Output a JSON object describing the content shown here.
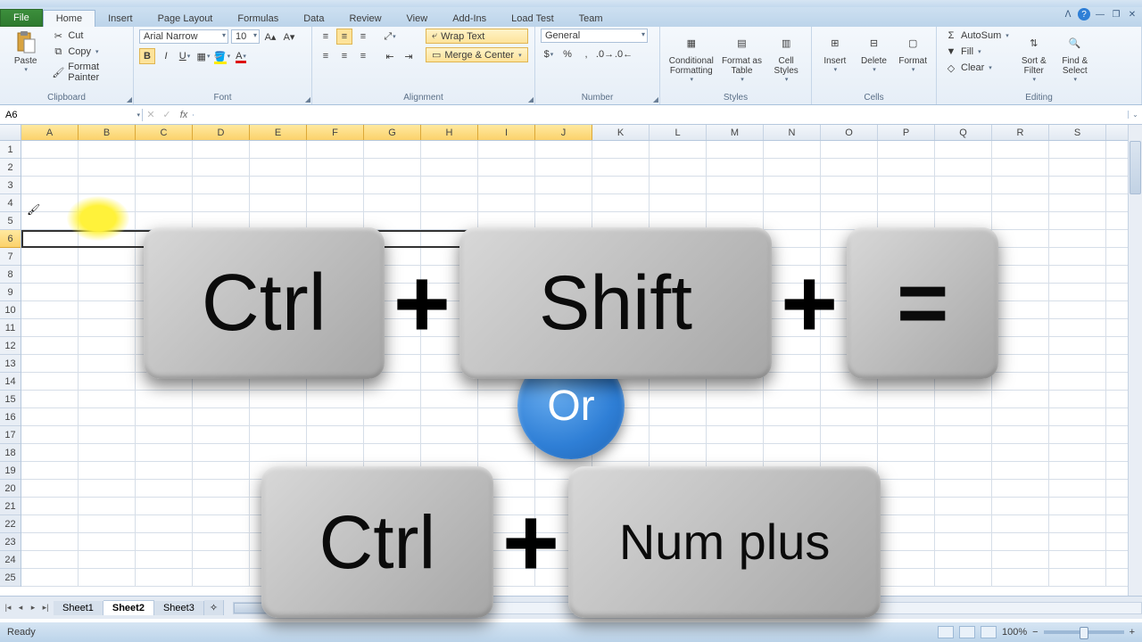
{
  "tabs": {
    "file": "File",
    "home": "Home",
    "insert": "Insert",
    "pageLayout": "Page Layout",
    "formulas": "Formulas",
    "data": "Data",
    "review": "Review",
    "view": "View",
    "addins": "Add-Ins",
    "loadtest": "Load Test",
    "team": "Team"
  },
  "clipboard": {
    "paste": "Paste",
    "cut": "Cut",
    "copy": "Copy",
    "formatPainter": "Format Painter",
    "title": "Clipboard"
  },
  "font": {
    "name": "Arial Narrow",
    "size": "10",
    "title": "Font"
  },
  "alignment": {
    "wrap": "Wrap Text",
    "merge": "Merge & Center",
    "title": "Alignment"
  },
  "number": {
    "format": "General",
    "title": "Number"
  },
  "styles": {
    "cond": "Conditional Formatting",
    "table": "Format as Table",
    "cell": "Cell Styles",
    "title": "Styles"
  },
  "cells": {
    "insert": "Insert",
    "delete": "Delete",
    "format": "Format",
    "title": "Cells"
  },
  "editing": {
    "autosum": "AutoSum",
    "fill": "Fill",
    "clear": "Clear",
    "sort": "Sort & Filter",
    "find": "Find & Select",
    "title": "Editing"
  },
  "namebox": "A6",
  "columns": [
    "A",
    "B",
    "C",
    "D",
    "E",
    "F",
    "G",
    "H",
    "I",
    "J",
    "K",
    "L",
    "M",
    "N",
    "O",
    "P",
    "Q",
    "R",
    "S"
  ],
  "selectedCols": 10,
  "rows": 25,
  "selectedRow": 6,
  "sheets": {
    "s1": "Sheet1",
    "s2": "Sheet2",
    "s3": "Sheet3"
  },
  "status": {
    "ready": "Ready",
    "zoom": "100%"
  },
  "keys": {
    "ctrl": "Ctrl",
    "shift": "Shift",
    "equals": "=",
    "or": "Or",
    "numplus": "Num plus"
  }
}
